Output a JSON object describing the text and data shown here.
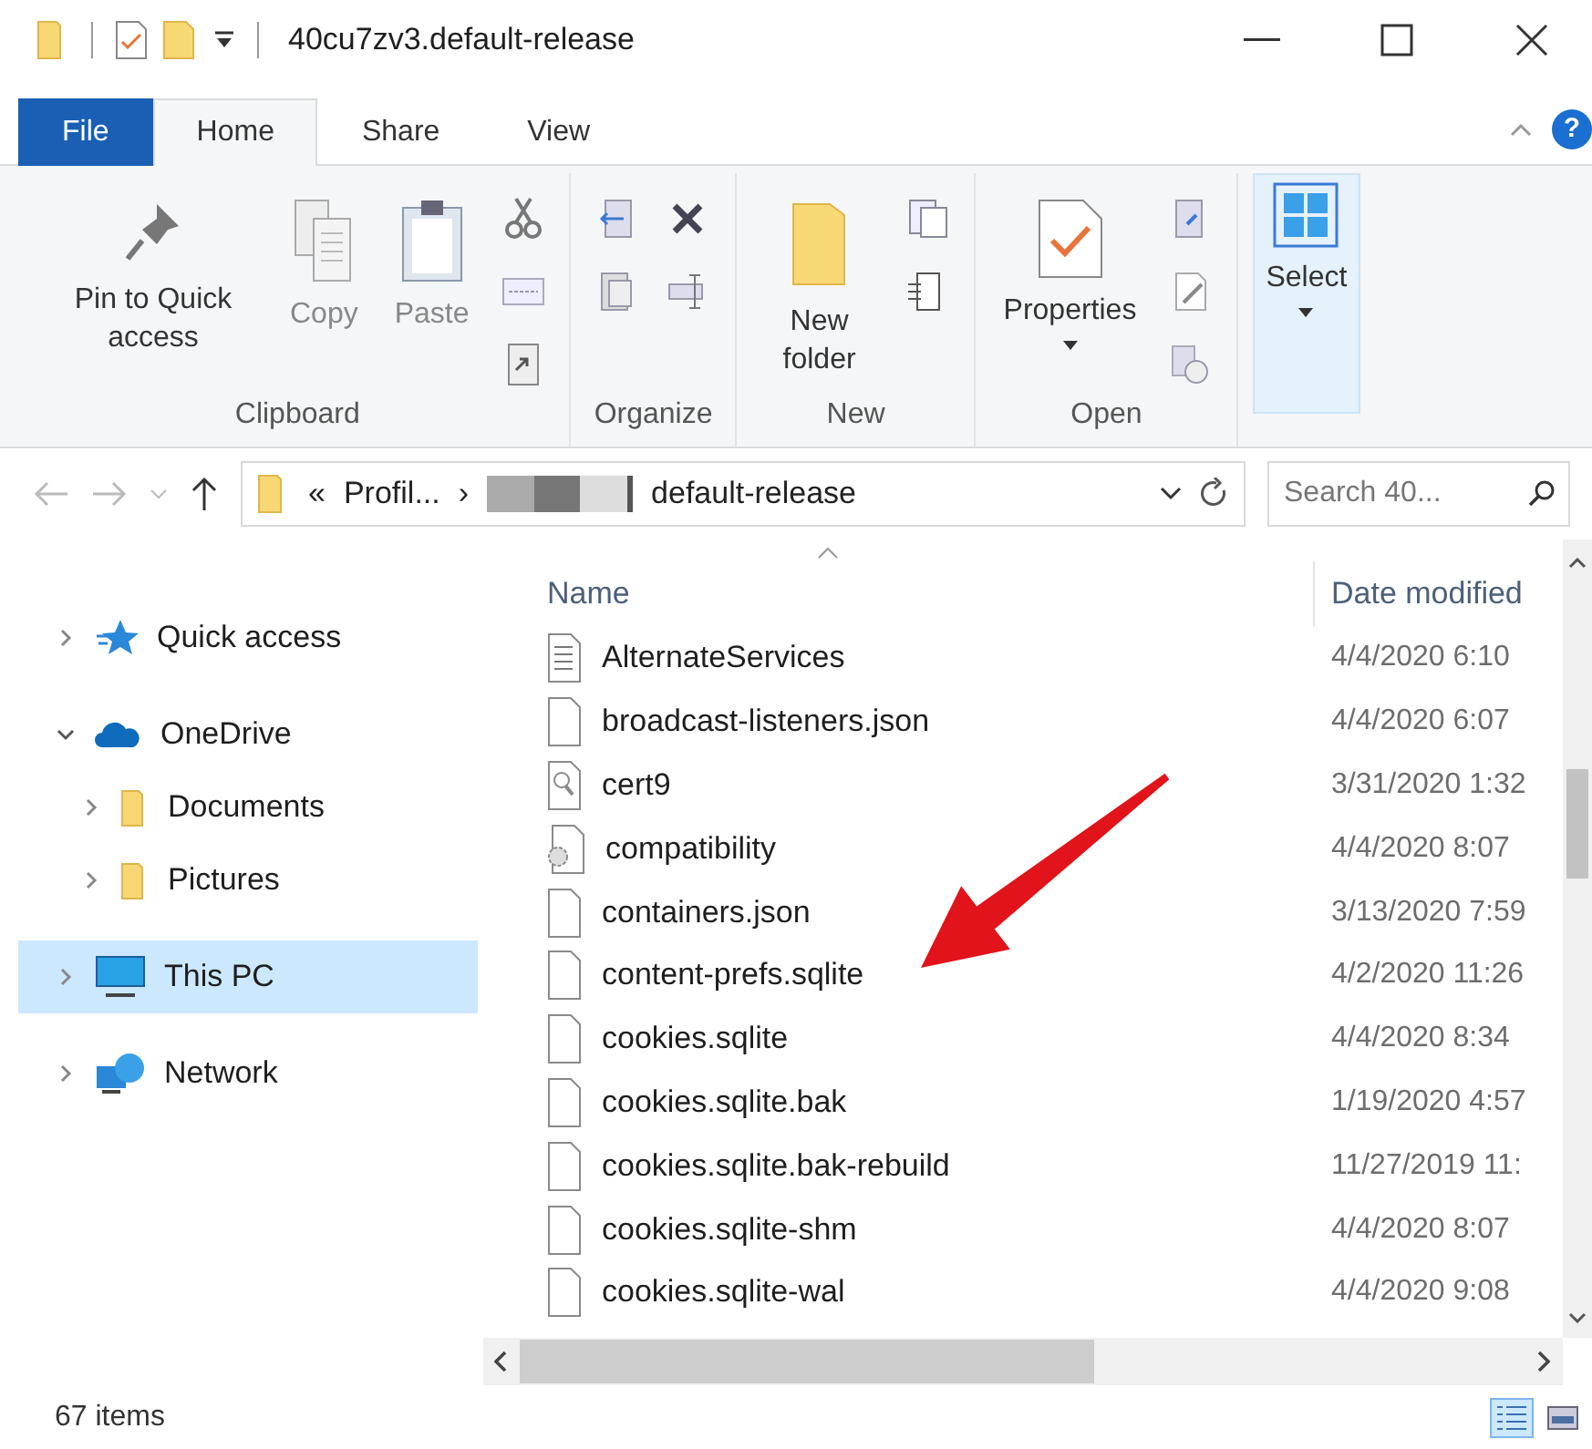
{
  "window": {
    "title": "40cu7zv3.default-release"
  },
  "ribbon_tabs": [
    {
      "label": "File",
      "kind": "file",
      "selected": false
    },
    {
      "label": "Home",
      "kind": "tab",
      "selected": true
    },
    {
      "label": "Share",
      "kind": "tab",
      "selected": false
    },
    {
      "label": "View",
      "kind": "tab",
      "selected": false
    }
  ],
  "help": "?",
  "ribbon_groups": [
    {
      "label": "Clipboard",
      "buttons": [
        {
          "label": "Pin to Quick access",
          "disabled": false,
          "dropdown": false,
          "highlighted": false
        },
        {
          "label": "Copy",
          "disabled": true,
          "dropdown": false,
          "highlighted": false
        },
        {
          "label": "Paste",
          "disabled": true,
          "dropdown": false,
          "highlighted": false
        }
      ]
    },
    {
      "label": "Organize"
    },
    {
      "label": "New",
      "buttons": [
        {
          "label": "New folder",
          "disabled": false,
          "dropdown": false,
          "highlighted": false
        }
      ]
    },
    {
      "label": "Open",
      "buttons": [
        {
          "label": "Properties",
          "disabled": false,
          "dropdown": true,
          "highlighted": false
        }
      ]
    },
    {
      "buttons": [
        {
          "label": "Select",
          "disabled": false,
          "dropdown": true,
          "highlighted": true
        }
      ]
    }
  ],
  "address": {
    "prefix": "«",
    "crumbs": [
      "Profil...",
      "default-release"
    ],
    "separator": "›"
  },
  "search": {
    "placeholder": "Search 40..."
  },
  "nav": [
    {
      "label": "Quick access",
      "kind": "star",
      "expanded": false,
      "selected": false
    },
    {
      "label": "OneDrive",
      "kind": "cloud",
      "expanded": true,
      "selected": false,
      "children": [
        {
          "label": "Documents",
          "kind": "folder",
          "expanded": false,
          "selected": false
        },
        {
          "label": "Pictures",
          "kind": "folder",
          "expanded": false,
          "selected": false
        }
      ]
    },
    {
      "label": "This PC",
      "kind": "pc",
      "expanded": false,
      "selected": true
    },
    {
      "label": "Network",
      "kind": "network",
      "expanded": false,
      "selected": false
    }
  ],
  "columns": [
    "Name",
    "Date modified"
  ],
  "files": [
    {
      "name": "AlternateServices",
      "date": "4/4/2020 6:10",
      "kind": "text"
    },
    {
      "name": "broadcast-listeners.json",
      "date": "4/4/2020 6:07",
      "kind": "blank"
    },
    {
      "name": "cert9",
      "date": "3/31/2020 1:32",
      "kind": "cert"
    },
    {
      "name": "compatibility",
      "date": "4/4/2020 8:07",
      "kind": "settings"
    },
    {
      "name": "containers.json",
      "date": "3/13/2020 7:59",
      "kind": "blank"
    },
    {
      "name": "content-prefs.sqlite",
      "date": "4/2/2020 11:26",
      "kind": "blank"
    },
    {
      "name": "cookies.sqlite",
      "date": "4/4/2020 8:34",
      "kind": "blank"
    },
    {
      "name": "cookies.sqlite.bak",
      "date": "1/19/2020 4:57",
      "kind": "blank"
    },
    {
      "name": "cookies.sqlite.bak-rebuild",
      "date": "11/27/2019 11:",
      "kind": "blank"
    },
    {
      "name": "cookies.sqlite-shm",
      "date": "4/4/2020 8:07",
      "kind": "blank"
    },
    {
      "name": "cookies.sqlite-wal",
      "date": "4/4/2020 9:08",
      "kind": "blank"
    }
  ],
  "status": {
    "count": "67 items"
  },
  "views": [
    {
      "kind": "details",
      "selected": true
    },
    {
      "kind": "large",
      "selected": false
    }
  ]
}
